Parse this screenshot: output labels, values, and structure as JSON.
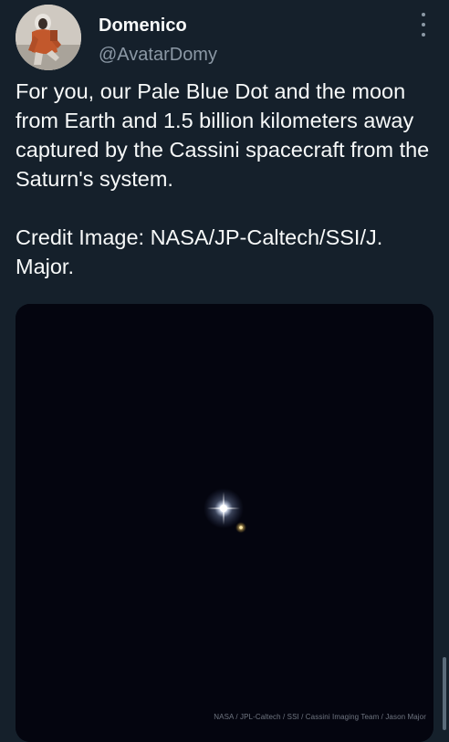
{
  "tweet": {
    "display_name": "Domenico",
    "handle": "@AvatarDomy",
    "text_paragraph_1": "For you, our Pale Blue Dot and the moon from Earth and 1.5 billion kilometers away captured by the Cassini spacecraft from the Saturn's system.",
    "text_paragraph_2": "Credit Image: NASA/JP-Caltech/SSI/J. Major."
  },
  "media": {
    "credit_caption": "NASA / JPL-Caltech / SSI / Cassini Imaging Team / Jason Major"
  },
  "icons": {
    "more": "more-vertical-icon",
    "avatar": "astronaut-avatar"
  },
  "colors": {
    "background": "#15202b",
    "text_primary": "#f7f9f9",
    "text_secondary": "#8b98a5",
    "space": "#050611"
  }
}
